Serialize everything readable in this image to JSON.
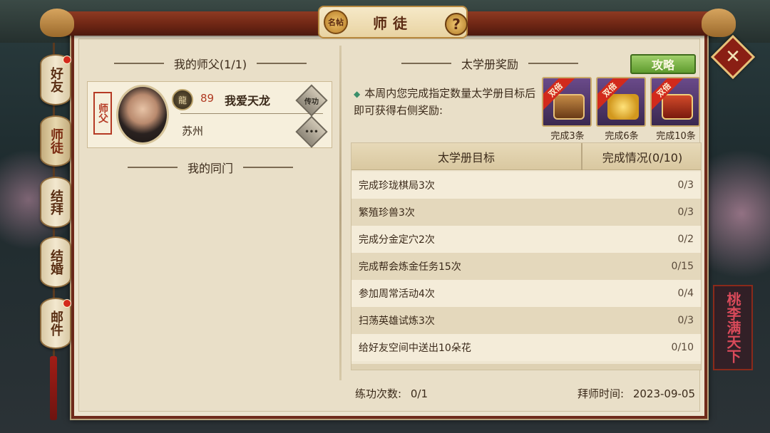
{
  "window": {
    "title": "师徒",
    "seal_text": "名帖",
    "help_label": "?",
    "close_label": "✕"
  },
  "side_tabs": [
    {
      "label": "好友",
      "badge": true
    },
    {
      "label": "师徒",
      "badge": false,
      "active": true
    },
    {
      "label": "结拜",
      "badge": false
    },
    {
      "label": "结婚",
      "badge": false
    },
    {
      "label": "邮件",
      "badge": true
    }
  ],
  "left": {
    "master_heading": "我的师父(1/1)",
    "master": {
      "tag": "师父",
      "level": "89",
      "name": "我爱天龙",
      "city": "苏州",
      "transfer_label": "传功",
      "more_label": "•••"
    },
    "classmates_heading": "我的同门"
  },
  "right": {
    "reward_heading": "太学册奖励",
    "strategy_label": "攻略",
    "description": "本周内您完成指定数量太学册目标后即可获得右侧奖励:",
    "rewards": [
      {
        "ribbon": "双倍",
        "label": "完成3条",
        "icon": "treasure-chest-icon"
      },
      {
        "ribbon": "双倍",
        "label": "完成6条",
        "icon": "gold-ingot-icon"
      },
      {
        "ribbon": "双倍",
        "label": "完成10条",
        "icon": "red-chest-icon"
      }
    ],
    "table": {
      "col_goal": "太学册目标",
      "col_status": "完成情况(0/10)",
      "rows": [
        {
          "task": "完成珍珑棋局3次",
          "progress": "0/3"
        },
        {
          "task": "繁殖珍兽3次",
          "progress": "0/3"
        },
        {
          "task": "完成分金定穴2次",
          "progress": "0/2"
        },
        {
          "task": "完成帮会炼金任务15次",
          "progress": "0/15"
        },
        {
          "task": "参加周常活动4次",
          "progress": "0/4"
        },
        {
          "task": "扫荡英雄试炼3次",
          "progress": "0/3"
        },
        {
          "task": "给好友空间中送出10朵花",
          "progress": "0/10"
        }
      ]
    }
  },
  "footer": {
    "practice_label": "练功次数:",
    "practice_value": "0/1",
    "apprentice_label": "拜师时间:",
    "apprentice_value": "2023-09-05"
  },
  "decor": {
    "plaque_text": "桃李满天下"
  },
  "colors": {
    "panel": "#ece3cd",
    "beam": "#6e2614",
    "accent_red": "#b03a22",
    "strategy_green": "#5f9b2e"
  }
}
